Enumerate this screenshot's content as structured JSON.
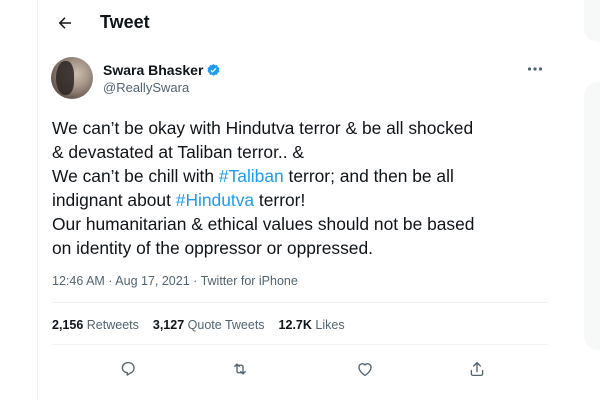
{
  "header": {
    "title": "Tweet"
  },
  "icons": {
    "back": "arrow-left-icon",
    "verified": "verified-badge-icon",
    "more": "more-horizontal-icon",
    "reply": "reply-icon",
    "retweet": "retweet-icon",
    "like": "heart-icon",
    "share": "share-icon"
  },
  "colors": {
    "accent": "#1d9bf0",
    "text": "#0f1419",
    "muted": "#536471"
  },
  "tweet": {
    "author": {
      "name": "Swara Bhasker",
      "handle": "@ReallySwara"
    },
    "text": {
      "l1": "We can’t be okay with Hindutva terror & be all shocked",
      "l2": "& devastated at Taliban terror.. &",
      "l3a": "We can’t be chill with ",
      "l3tag": "#Taliban",
      "l3b": " terror; and then be all",
      "l4a": "indignant about ",
      "l4tag": "#Hindutva",
      "l4b": " terror!",
      "l5": "Our humanitarian & ethical values should not be based",
      "l6": "on identity of the oppressor or oppressed."
    },
    "time": "12:46 AM",
    "separator": "·",
    "date": "Aug 17, 2021",
    "source": "Twitter for iPhone",
    "stats": {
      "retweets_count": "2,156",
      "retweets_label": "Retweets",
      "quotes_count": "3,127",
      "quotes_label": "Quote Tweets",
      "likes_count": "12.7K",
      "likes_label": "Likes"
    }
  }
}
